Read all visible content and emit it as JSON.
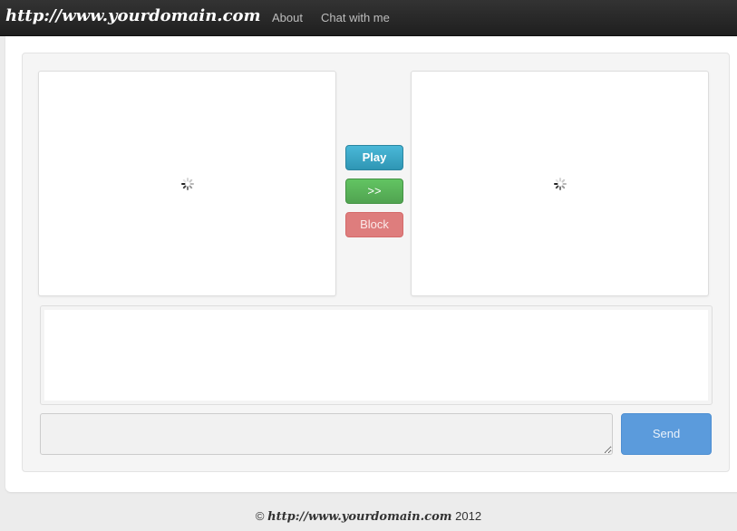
{
  "navbar": {
    "brand": "http://www.yourdomain.com",
    "links": [
      {
        "label": "About",
        "icon": ""
      },
      {
        "label": "Chat with me",
        "icon": ""
      }
    ]
  },
  "videos": {
    "left": {
      "state": "loading",
      "icon": "spinner-icon"
    },
    "right": {
      "state": "loading",
      "icon": "spinner-icon"
    }
  },
  "controls": {
    "play_label": "Play",
    "next_label": ">>",
    "block_label": "Block"
  },
  "chat": {
    "log_text": "",
    "input_value": "",
    "send_label": "Send"
  },
  "footer": {
    "copyright": "©",
    "domain": "http://www.yourdomain.com",
    "year": "2012"
  },
  "colors": {
    "navbar": "#222222",
    "play": "#2f96b4",
    "next": "#51a351",
    "block": "#de7d7d",
    "send": "#5b9bdc"
  }
}
